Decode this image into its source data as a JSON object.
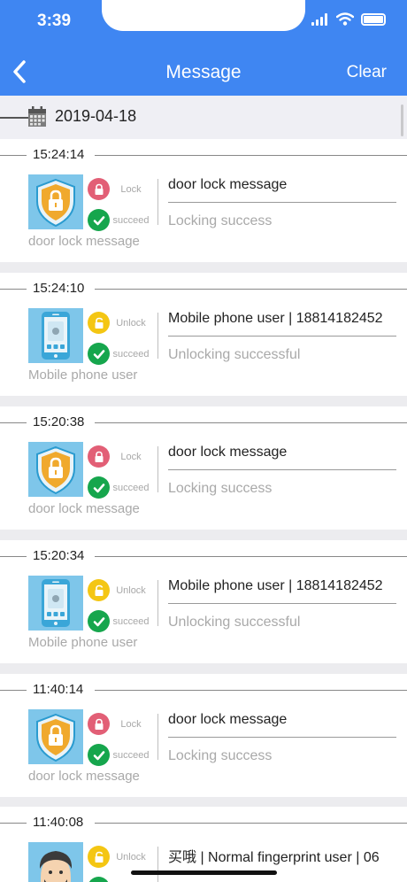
{
  "status_bar": {
    "time": "3:39"
  },
  "header": {
    "title": "Message",
    "clear_label": "Clear"
  },
  "date_section": {
    "date": "2019-04-18"
  },
  "records": [
    {
      "time": "15:24:14",
      "thumb": "shield-lock",
      "action": "Lock",
      "result": "succeed",
      "title": "door lock message",
      "status": "Locking success",
      "source": "door lock message"
    },
    {
      "time": "15:24:10",
      "thumb": "phone",
      "action": "Unlock",
      "result": "succeed",
      "title": "Mobile phone user | 18814182452",
      "status": "Unlocking successful",
      "source": "Mobile phone user"
    },
    {
      "time": "15:20:38",
      "thumb": "shield-lock",
      "action": "Lock",
      "result": "succeed",
      "title": "door lock message",
      "status": "Locking success",
      "source": "door lock message"
    },
    {
      "time": "15:20:34",
      "thumb": "phone",
      "action": "Unlock",
      "result": "succeed",
      "title": "Mobile phone user | 18814182452",
      "status": "Unlocking successful",
      "source": "Mobile phone user"
    },
    {
      "time": "11:40:14",
      "thumb": "shield-lock",
      "action": "Lock",
      "result": "succeed",
      "title": "door lock message",
      "status": "Locking success",
      "source": "door lock message"
    },
    {
      "time": "11:40:08",
      "thumb": "avatar",
      "action": "Unlock",
      "result": "succeed",
      "title": "买哦 | Normal fingerprint user | 06",
      "status": "",
      "source": ""
    }
  ],
  "colors": {
    "header": "#3f86f2",
    "lock": "#e25f76",
    "unlock": "#f4c613",
    "succeed": "#16a64d",
    "thumb_bg": "#7ec6ea"
  }
}
